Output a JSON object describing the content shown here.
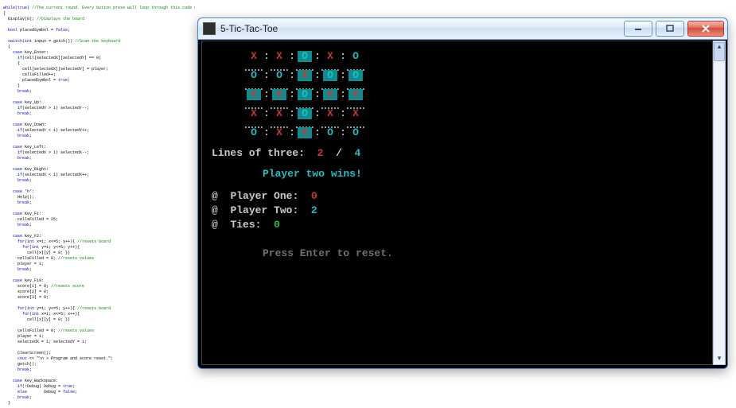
{
  "window": {
    "title": "5-Tic-Tac-Toe",
    "buttons": {
      "min": "–",
      "max": "□",
      "close": "×"
    }
  },
  "board": {
    "rows": [
      [
        {
          "v": "X",
          "hl": false
        },
        {
          "v": "X",
          "hl": false
        },
        {
          "v": "O",
          "hl": true
        },
        {
          "v": "X",
          "hl": false
        },
        {
          "v": "O",
          "hl": false
        }
      ],
      [
        {
          "v": "O",
          "hl": false
        },
        {
          "v": "O",
          "hl": false
        },
        {
          "v": "X",
          "hl": true
        },
        {
          "v": "O",
          "hl": true
        },
        {
          "v": "O",
          "hl": true
        }
      ],
      [
        {
          "v": "X",
          "hl": true
        },
        {
          "v": "X",
          "hl": true
        },
        {
          "v": "O",
          "hl": true
        },
        {
          "v": "X",
          "hl": true
        },
        {
          "v": "X",
          "hl": true
        }
      ],
      [
        {
          "v": "X",
          "hl": false
        },
        {
          "v": "X",
          "hl": false
        },
        {
          "v": "O",
          "hl": true
        },
        {
          "v": "X",
          "hl": false
        },
        {
          "v": "X",
          "hl": false
        }
      ],
      [
        {
          "v": "O",
          "hl": false
        },
        {
          "v": "X",
          "hl": false
        },
        {
          "v": "X",
          "hl": true
        },
        {
          "v": "O",
          "hl": false
        },
        {
          "v": "O",
          "hl": false
        }
      ]
    ],
    "sep_char": ":"
  },
  "lines_of_three": {
    "label": "Lines of three:",
    "p1": "2",
    "slash": "/",
    "p2": "4"
  },
  "winner": "Player two wins!",
  "score": {
    "bullet": "@",
    "p1": {
      "label": "Player One:",
      "value": "0"
    },
    "p2": {
      "label": "Player Two:",
      "value": "2"
    },
    "ties": {
      "label": "Ties:",
      "value": "0"
    }
  },
  "prompt": "Press Enter to reset.",
  "editor_code": "while(true) //The current round. Every button press will loop through this code until someone wins.\n{\n  Display(0); //Displays the board\n\n  bool placedSymbol = false;\n\n  switch(int input = getch()) //Scan the keyboard\n  {\n    case Key_Enter:\n      if(cell[selectedX][selectedY] == 0)\n      {\n        cell[selectedX][selectedY] = player;\n        cellsFilled++;\n        placedSymbol = true;\n      }\n      break;\n\n    case Key_Up:\n      if(selectedY > 1) selectedY--;\n      break;\n\n    case Key_Down:\n      if(selectedY < 1) selectedY++;\n      break;\n\n    case Key_Left:\n      if(selectedX > 1) selectedX--;\n      break;\n\n    case Key_Right:\n      if(selectedX < 1) selectedX++;\n      break;\n\n    case 'h':\n      Help();\n      break;\n\n    case Key_F1:\n      cellsFilled = 25;\n      break;\n\n    case Key_F2:\n      for(int x=1; x<=5; x++){ //resets board\n        for(int y=1; y<=5; y++){\n          cell[x][y] = 0; }}\n      cellsFilled = 0; //resets values\n      player = 1;\n      break;\n\n    case Key_F10:\n      score[1] = 0; //resets score\n      score[2] = 0;\n      score[3] = 0;\n\n      for(int y=1; y<=5; y++){ //resets board\n        for(int x=1; x<=5; x++){\n          cell[x][y] = 0; }}\n\n      cellsFilled = 0; //resets values\n      player = 1;\n      selectedX = 1; selectedY = 1;\n\n      ClearScreen();\n      cout << \"\\n > Program and score reset.\";\n      getch();\n      break;\n\n    case Key_Backspace:\n      if(!Debug) Debug = true;\n      else       Debug = false;\n      break;\n  }"
}
